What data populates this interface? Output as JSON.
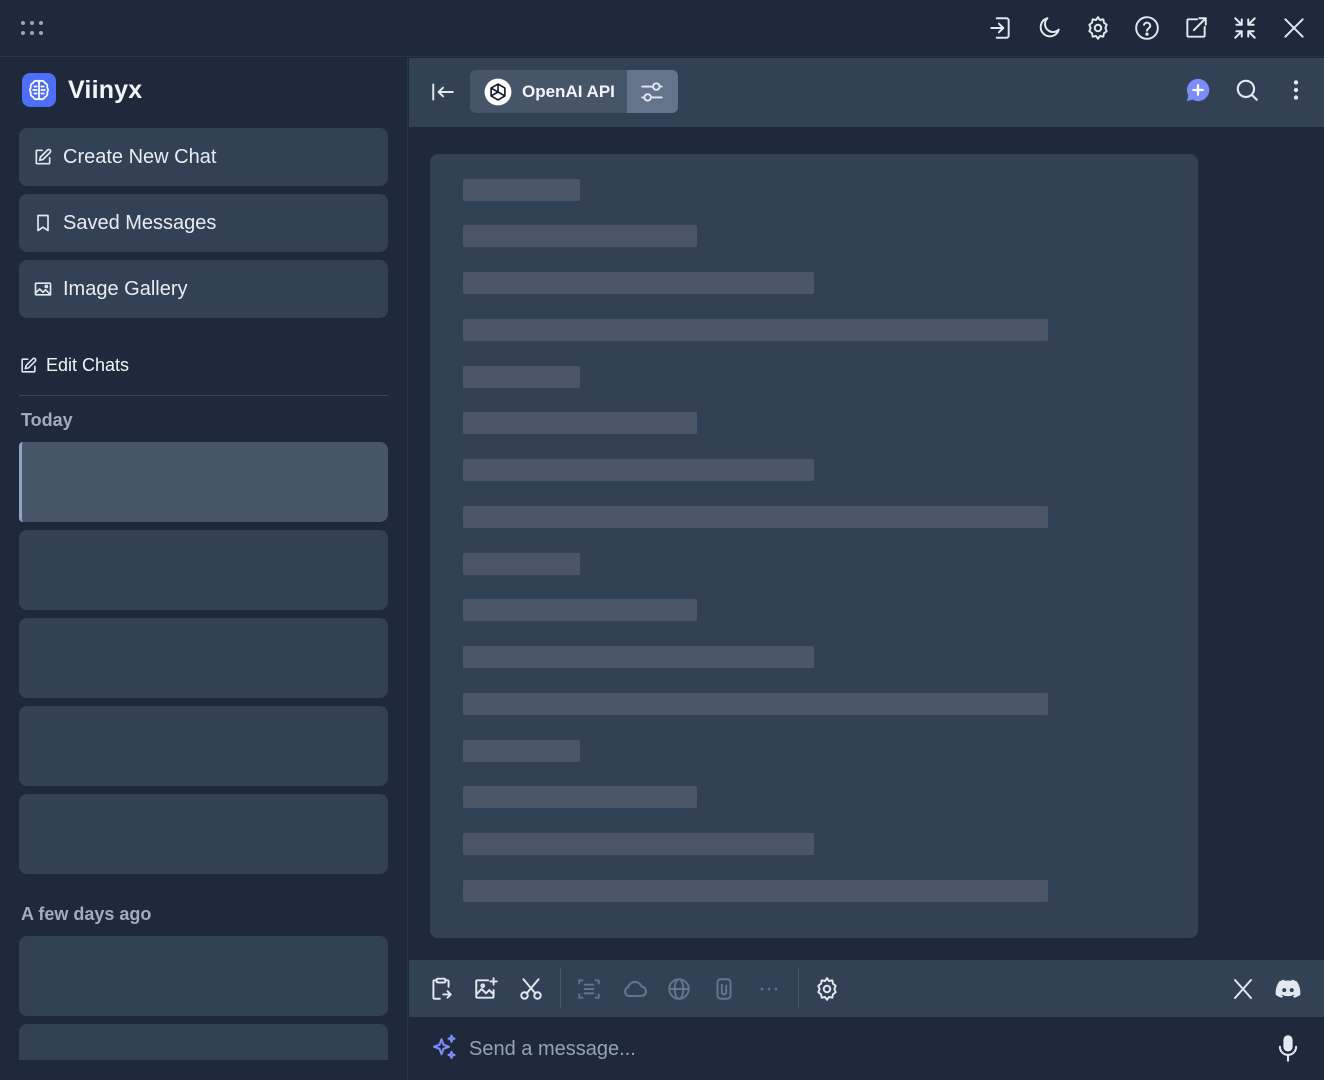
{
  "brand": {
    "name": "Viinyx"
  },
  "sidebar": {
    "nav": [
      {
        "label": "Create New Chat",
        "icon": "edit-icon"
      },
      {
        "label": "Saved Messages",
        "icon": "bookmark-icon"
      },
      {
        "label": "Image Gallery",
        "icon": "image-icon"
      }
    ],
    "edit_chats": "Edit Chats",
    "sections": [
      {
        "label": "Today",
        "items": 5
      },
      {
        "label": "A few days ago",
        "items": 2
      }
    ]
  },
  "header": {
    "model_name": "OpenAI API"
  },
  "input": {
    "placeholder": "Send a message..."
  },
  "colors": {
    "accent": "#7c8cf8",
    "background": "#1e293b",
    "panel": "#334155"
  },
  "icons": {
    "titlebar": [
      "grip-dots-icon",
      "sign-in-icon",
      "moon-icon",
      "gear-icon",
      "help-icon",
      "external-link-icon",
      "collapse-icon",
      "close-icon"
    ],
    "header": [
      "collapse-sidebar-icon",
      "openai-logo-icon",
      "settings-sliders-icon",
      "new-chat-bubble-icon",
      "search-icon",
      "more-vertical-icon"
    ],
    "toolbar": [
      "clipboard-icon",
      "image-add-icon",
      "scissors-icon",
      "scan-text-icon",
      "cloud-icon",
      "globe-icon",
      "paperclip-icon",
      "ellipsis-icon",
      "gear-icon",
      "x-logo-icon",
      "discord-icon"
    ],
    "input": [
      "sparkles-icon",
      "microphone-icon"
    ]
  }
}
